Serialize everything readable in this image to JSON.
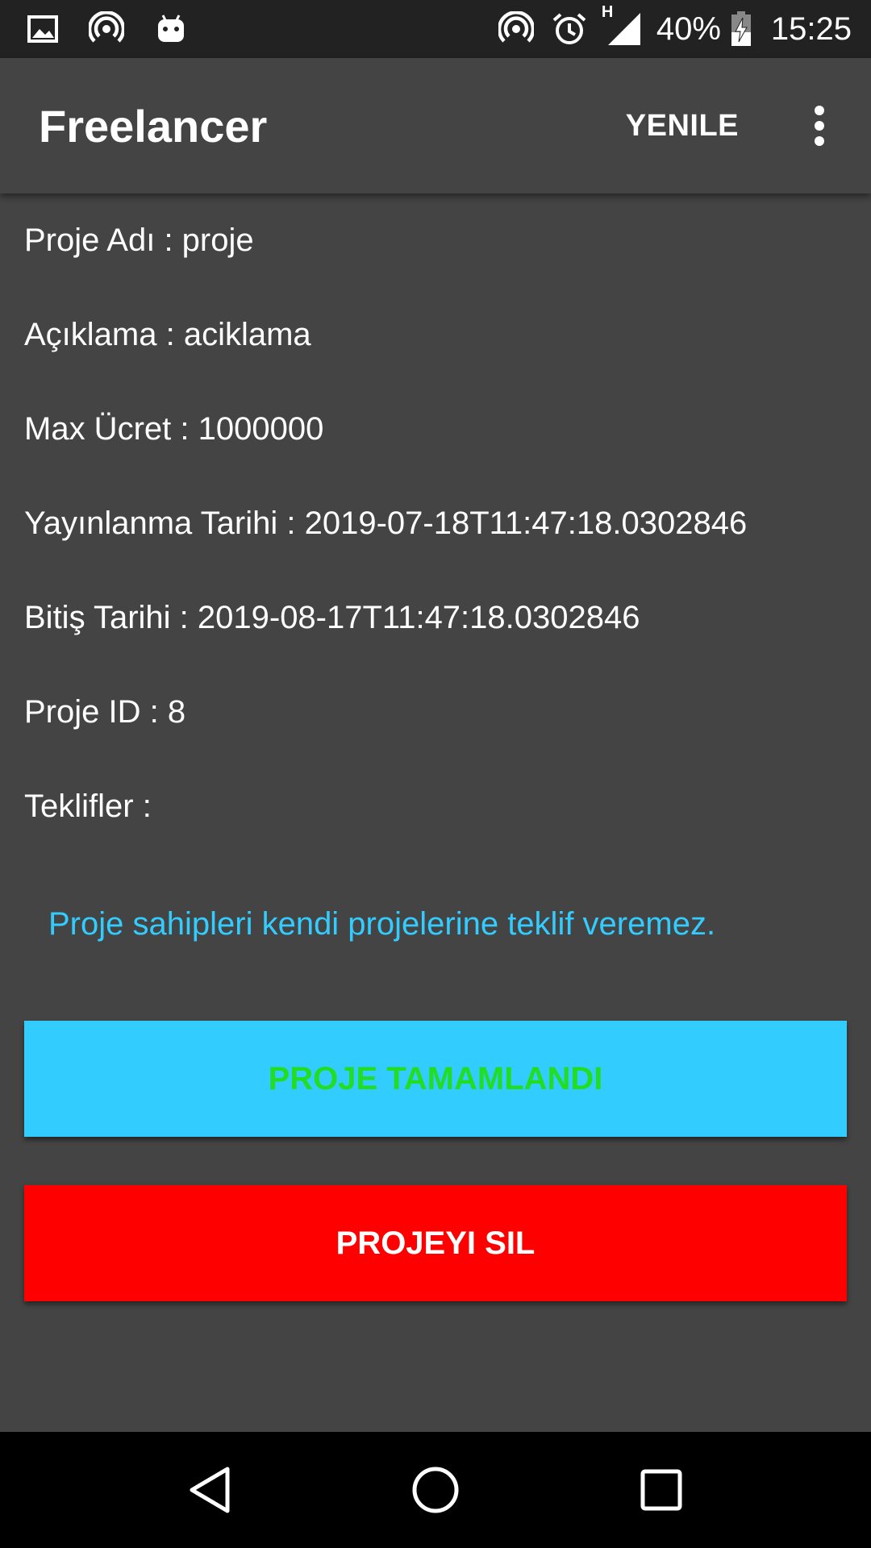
{
  "status_bar": {
    "icons_left": [
      "image-icon",
      "hotspot-icon",
      "android-icon"
    ],
    "icons_right": [
      "hotspot-icon",
      "alarm-icon",
      "signal-icon",
      "battery-icon"
    ],
    "network_type": "H",
    "battery": "40%",
    "time": "15:25"
  },
  "app_bar": {
    "title": "Freelancer",
    "action": "YENILE",
    "overflow_icon": "more-vert-icon"
  },
  "project": {
    "name": "Proje Adı : proje",
    "description": "Açıklama : aciklama",
    "max_fee": "Max Ücret : 1000000",
    "publish_date": "Yayınlanma Tarihi : 2019-07-18T11:47:18.0302846",
    "end_date": "Bitiş Tarihi : 2019-08-17T11:47:18.0302846",
    "id": "Proje ID : 8",
    "offers": "Teklifler :"
  },
  "note": "Proje sahipleri kendi projelerine teklif veremez.",
  "buttons": {
    "complete": "PROJE TAMAMLANDI",
    "delete": "PROJEYI SIL"
  },
  "colors": {
    "background": "#444444",
    "accent": "#33ccff",
    "complete_text": "#22dd22",
    "delete_bg": "#ff0000"
  },
  "nav_bar": {
    "icons": [
      "back-icon",
      "home-icon",
      "recents-icon"
    ]
  }
}
